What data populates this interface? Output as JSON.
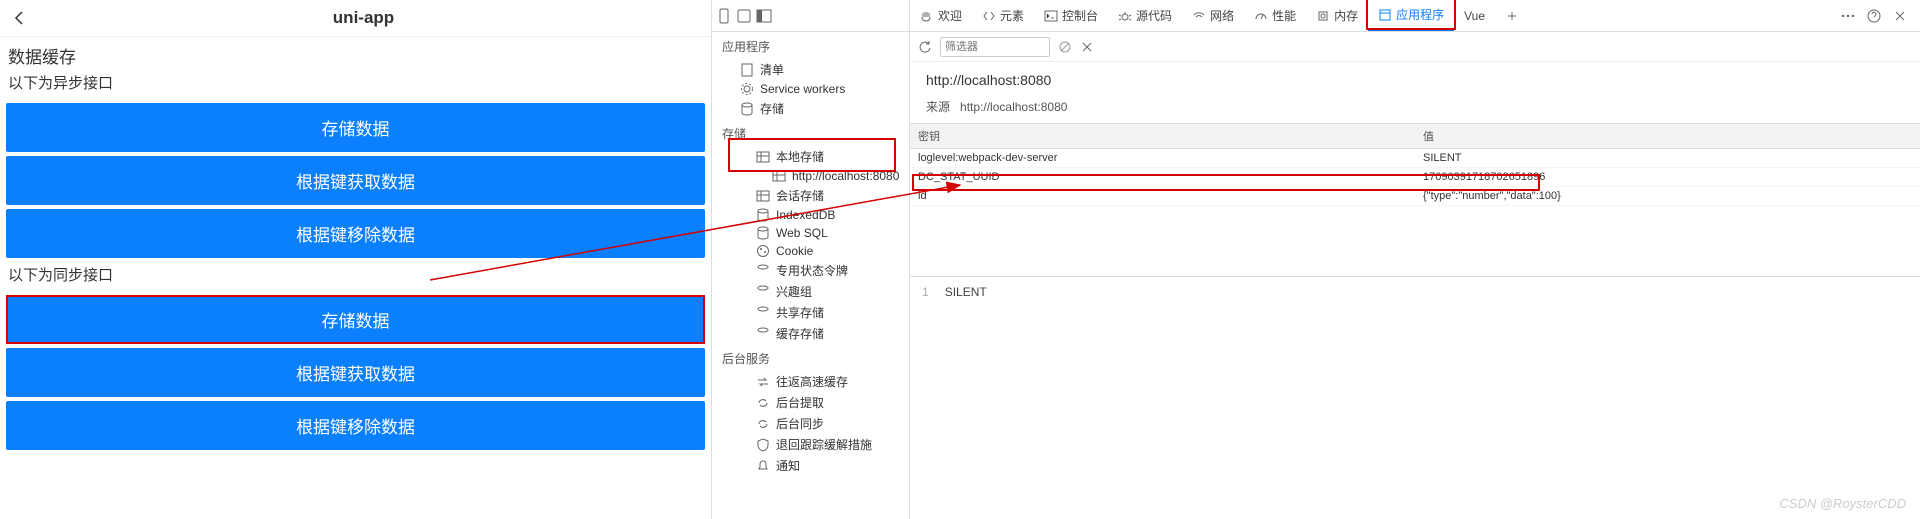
{
  "app": {
    "title": "uni-app",
    "section_title": "数据缓存",
    "async_label": "以下为异步接口",
    "sync_label": "以下为同步接口",
    "buttons_async": [
      "存储数据",
      "根据键获取数据",
      "根据键移除数据"
    ],
    "buttons_sync": [
      "存储数据",
      "根据键获取数据",
      "根据键移除数据"
    ]
  },
  "devtools": {
    "tabs": {
      "welcome": "欢迎",
      "elements": "元素",
      "console": "控制台",
      "sources": "源代码",
      "network": "网络",
      "performance": "性能",
      "memory": "内存",
      "application": "应用程序",
      "vue": "Vue"
    },
    "sidebar": {
      "app_section": "应用程序",
      "manifest": "清单",
      "service_workers": "Service workers",
      "storage": "存储",
      "storage_section": "存储",
      "local_storage": "本地存储",
      "local_origin": "http://localhost:8080",
      "session_storage": "会话存储",
      "indexeddb": "IndexedDB",
      "websql": "Web SQL",
      "cookie": "Cookie",
      "trust_tokens": "专用状态令牌",
      "interest_groups": "兴趣组",
      "shared_storage": "共享存储",
      "cache_storage": "缓存存储",
      "bg_section": "后台服务",
      "bfcache": "往返高速缓存",
      "bg_fetch": "后台提取",
      "bg_sync": "后台同步",
      "bounce": "退回跟踪缓解措施",
      "notifications": "通知"
    },
    "filter": {
      "placeholder": "筛选器"
    },
    "storage_view": {
      "heading": "http://localhost:8080",
      "origin_label": "来源",
      "origin_value": "http://localhost:8080",
      "col_key": "密钥",
      "col_value": "值",
      "rows": [
        {
          "k": "loglevel:webpack-dev-server",
          "v": "SILENT"
        },
        {
          "k": "DC_STAT_UUID",
          "v": "17090391718702651896"
        },
        {
          "k": "id",
          "v": "{\"type\":\"number\",\"data\":100}"
        }
      ],
      "viewer_line": "1",
      "viewer_value": "SILENT"
    }
  },
  "watermark": "CSDN @RoysterCDD"
}
